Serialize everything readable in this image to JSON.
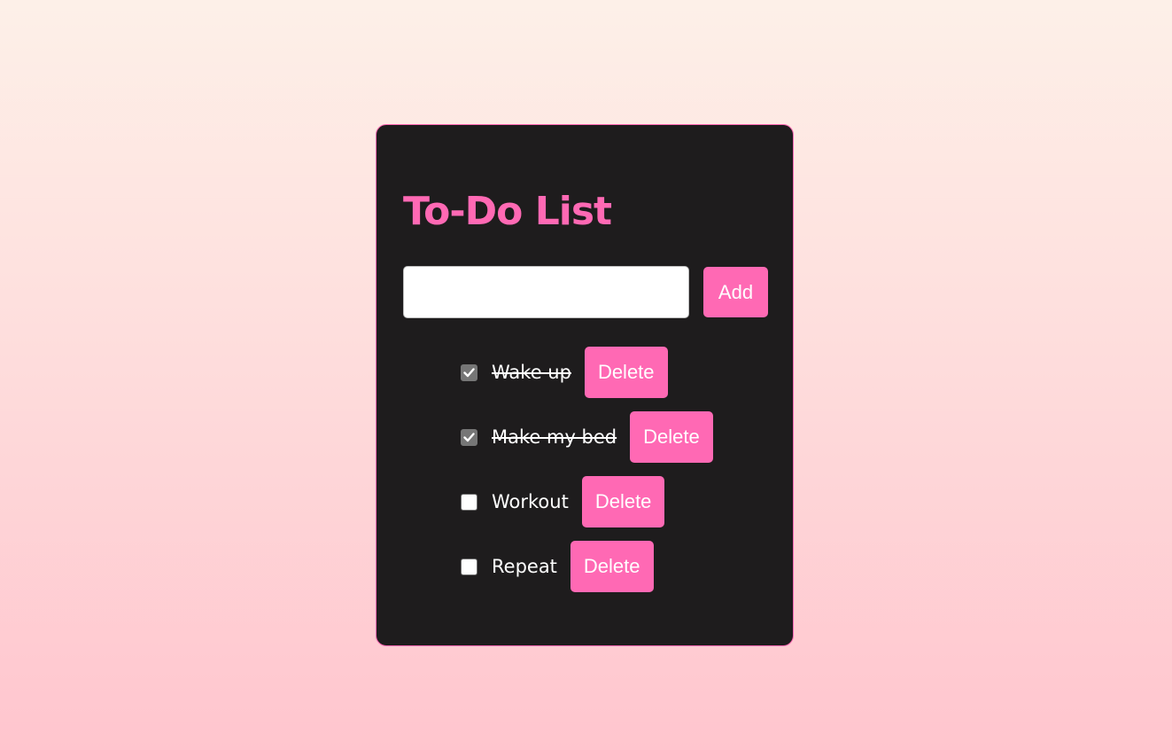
{
  "app": {
    "title": "To-Do List"
  },
  "input": {
    "value": "",
    "placeholder": ""
  },
  "add_button": {
    "label": "Add"
  },
  "tasks": [
    {
      "text": "Wake up",
      "completed": true,
      "delete_label": "Delete"
    },
    {
      "text": "Make my bed",
      "completed": true,
      "delete_label": "Delete"
    },
    {
      "text": "Workout",
      "completed": false,
      "delete_label": "Delete"
    },
    {
      "text": "Repeat",
      "completed": false,
      "delete_label": "Delete"
    }
  ],
  "colors": {
    "accent": "#ff69b4",
    "card_background": "#1e1c1d",
    "text": "#ffffff",
    "checkbox_checked": "#767676"
  }
}
